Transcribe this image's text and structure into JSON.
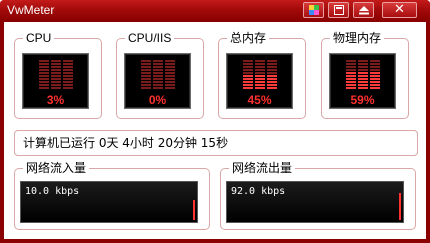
{
  "window": {
    "title": "VwMeter"
  },
  "titlebar_buttons": [
    {
      "name": "colorful-icon"
    },
    {
      "name": "restore-icon"
    },
    {
      "name": "minimize-tray-icon"
    },
    {
      "name": "close-icon"
    }
  ],
  "gauges": [
    {
      "label": "CPU",
      "value": "3%",
      "level": 0.03
    },
    {
      "label": "CPU/IIS",
      "value": "0%",
      "level": 0.0
    },
    {
      "label": "总内存",
      "value": "45%",
      "level": 0.45
    },
    {
      "label": "物理内存",
      "value": "59%",
      "level": 0.59
    }
  ],
  "uptime": "计算机已运行 0天 4小时 20分钟 15秒",
  "network": [
    {
      "label": "网络流入量",
      "value": "10.0 kbps",
      "bar_level": 0.55
    },
    {
      "label": "网络流出量",
      "value": "92.0 kbps",
      "bar_level": 0.75
    }
  ],
  "colors": {
    "frame": "#8b0000",
    "accent": "#ff3030",
    "border": "#d9a7a7"
  }
}
